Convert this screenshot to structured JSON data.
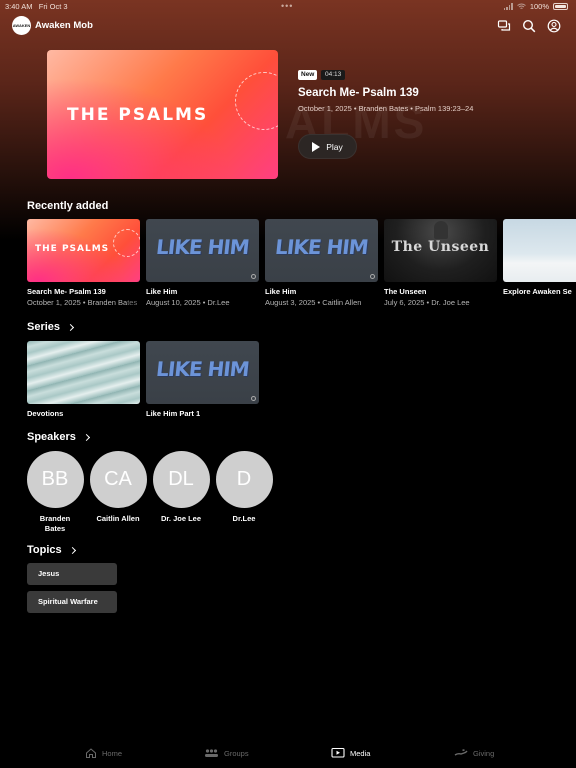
{
  "status_bar": {
    "time": "3:40 AM",
    "date": "Fri Oct 3",
    "battery": "100%"
  },
  "header": {
    "logo_text": "AWAKEN",
    "app_title": "Awaken Mob"
  },
  "hero": {
    "art_text": "THE PSALMS",
    "bg_word": "ALMS",
    "badge_new": "New",
    "duration": "04:13",
    "title": "Search Me- Psalm 139",
    "meta": "October 1, 2025 • Branden Bates • Psalm 139:23–24",
    "play_label": "Play"
  },
  "recently_added": {
    "title": "Recently added",
    "items": [
      {
        "thumb_text": "THE PSALMS",
        "title": "Search Me- Psalm 139",
        "sub": "October 1, 2025 • Branden Ba",
        "sub_fade": "tes"
      },
      {
        "thumb_text": "LIKE HIM",
        "title": "Like Him",
        "sub": "August 10, 2025 • Dr.Lee",
        "sub_fade": ""
      },
      {
        "thumb_text": "LIKE HIM",
        "title": "Like Him",
        "sub": "August 3, 2025 • Caitlin Allen",
        "sub_fade": ""
      },
      {
        "thumb_text": "The Unseen",
        "title": "The Unseen",
        "sub": "July 6, 2025 • Dr. Joe Lee",
        "sub_fade": ""
      },
      {
        "thumb_text": "",
        "title": "Explore Awaken Se",
        "sub": "",
        "sub_fade": ""
      }
    ]
  },
  "series": {
    "title": "Series",
    "items": [
      {
        "title": "Devotions"
      },
      {
        "thumb_text": "LIKE HIM",
        "title": "Like Him Part 1"
      }
    ]
  },
  "speakers": {
    "title": "Speakers",
    "items": [
      {
        "initials": "BB",
        "name": "Branden Bates"
      },
      {
        "initials": "CA",
        "name": "Caitlin Allen"
      },
      {
        "initials": "DL",
        "name": "Dr. Joe Lee"
      },
      {
        "initials": "D",
        "name": "Dr.Lee"
      }
    ]
  },
  "topics": {
    "title": "Topics",
    "items": [
      {
        "label": "Jesus"
      },
      {
        "label": "Spiritual Warfare"
      }
    ]
  },
  "tabbar": {
    "items": [
      {
        "label": "Home",
        "icon": "home-icon"
      },
      {
        "label": "Groups",
        "icon": "groups-icon"
      },
      {
        "label": "Media",
        "icon": "media-icon",
        "active": true
      },
      {
        "label": "Giving",
        "icon": "giving-icon"
      }
    ]
  },
  "colors": {
    "accent": "#ff4f3a",
    "background": "#000000",
    "header_gradient": "#7a3422"
  }
}
